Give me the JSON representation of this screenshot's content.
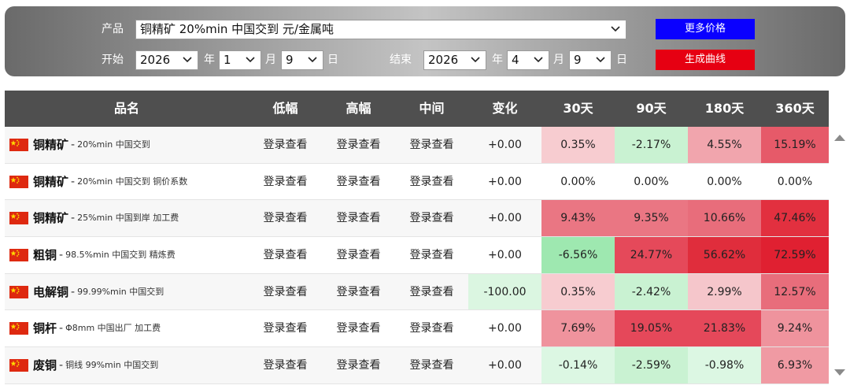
{
  "filters": {
    "product_label": "产品",
    "product_value": "铜精矿 20%min 中国交到 元/金属吨",
    "start_label": "开始",
    "start_year": "2026",
    "start_month": "1",
    "start_day": "9",
    "end_label": "结束",
    "end_year": "2026",
    "end_month": "4",
    "end_day": "9",
    "year_unit": "年",
    "month_unit": "月",
    "day_unit": "日",
    "more_prices_label": "更多价格",
    "make_chart_label": "生成曲线"
  },
  "table": {
    "headers": [
      "品名",
      "低幅",
      "高幅",
      "中间",
      "变化",
      "30天",
      "90天",
      "180天",
      "360天"
    ],
    "rows": [
      {
        "name": "铜精矿",
        "sep": "-",
        "desc": "20%min 中国交到",
        "low": "登录查看",
        "high": "登录查看",
        "mid": "登录查看",
        "change": "+0.00",
        "d30": "0.35%",
        "d90": "-2.17%",
        "d180": "4.55%",
        "d360": "15.19%"
      },
      {
        "name": "铜精矿",
        "sep": "-",
        "desc": "20%min 中国交到 铜价系数",
        "low": "登录查看",
        "high": "登录查看",
        "mid": "登录查看",
        "change": "+0.00",
        "d30": "0.00%",
        "d90": "0.00%",
        "d180": "0.00%",
        "d360": "0.00%"
      },
      {
        "name": "铜精矿",
        "sep": "-",
        "desc": "25%min 中国到岸 加工费",
        "low": "登录查看",
        "high": "登录查看",
        "mid": "登录查看",
        "change": "+0.00",
        "d30": "9.43%",
        "d90": "9.35%",
        "d180": "10.66%",
        "d360": "47.46%"
      },
      {
        "name": "粗铜",
        "sep": "-",
        "desc": "98.5%min 中国交到 精炼费",
        "low": "登录查看",
        "high": "登录查看",
        "mid": "登录查看",
        "change": "+0.00",
        "d30": "-6.56%",
        "d90": "24.77%",
        "d180": "56.62%",
        "d360": "72.59%"
      },
      {
        "name": "电解铜",
        "sep": "-",
        "desc": "99.99%min 中国交到",
        "low": "登录查看",
        "high": "登录查看",
        "mid": "登录查看",
        "change": "-100.00",
        "d30": "0.35%",
        "d90": "-2.42%",
        "d180": "2.99%",
        "d360": "12.57%"
      },
      {
        "name": "铜杆",
        "sep": "-",
        "desc": "Φ8mm 中国出厂 加工费",
        "low": "登录查看",
        "high": "登录查看",
        "mid": "登录查看",
        "change": "+0.00",
        "d30": "7.69%",
        "d90": "19.05%",
        "d180": "21.83%",
        "d360": "9.24%"
      },
      {
        "name": "废铜",
        "sep": "-",
        "desc": "铜线 99%min 中国交到",
        "low": "登录查看",
        "high": "登录查看",
        "mid": "登录查看",
        "change": "+0.00",
        "d30": "-0.14%",
        "d90": "-2.59%",
        "d180": "-0.98%",
        "d360": "6.93%"
      }
    ],
    "cell_colors": [
      {
        "change": "",
        "d30": "#f7ccd0",
        "d90": "#c9f2d2",
        "d180": "#f1a5ad",
        "d360": "#e65a69"
      },
      {
        "change": "",
        "d30": "",
        "d90": "",
        "d180": "",
        "d360": ""
      },
      {
        "change": "",
        "d30": "#ea7683",
        "d90": "#ea7683",
        "d180": "#e86d7b",
        "d360": "#e2303f"
      },
      {
        "change": "",
        "d30": "#9ee8b0",
        "d90": "#e5495a",
        "d180": "#e02d3c",
        "d360": "#e02031"
      },
      {
        "change": "#dbf6e1",
        "d30": "#f7ccd0",
        "d90": "#c9f2d2",
        "d180": "#f5c6cb",
        "d360": "#e86d7b"
      },
      {
        "change": "",
        "d30": "#ef939d",
        "d90": "#e5485a",
        "d180": "#e5485a",
        "d360": "#ef939d"
      },
      {
        "change": "",
        "d30": "#dcf7e3",
        "d90": "#c9f2d2",
        "d180": "#dcf7e3",
        "d360": "#f09aa3"
      }
    ],
    "flag_icon": "china-flag-icon"
  },
  "colors": {
    "header_bg": "#4f4f4f",
    "more_button": "#0a00ff",
    "chart_button": "#e60012"
  }
}
